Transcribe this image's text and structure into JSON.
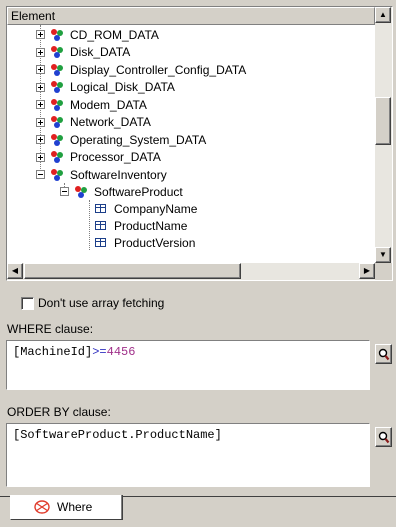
{
  "tree": {
    "header": "Element",
    "items": [
      {
        "label": "CD_ROM_DATA",
        "expander": "plus"
      },
      {
        "label": "Disk_DATA",
        "expander": "plus"
      },
      {
        "label": "Display_Controller_Config_DATA",
        "expander": "plus"
      },
      {
        "label": "Logical_Disk_DATA",
        "expander": "plus"
      },
      {
        "label": "Modem_DATA",
        "expander": "plus"
      },
      {
        "label": "Network_DATA",
        "expander": "plus"
      },
      {
        "label": "Operating_System_DATA",
        "expander": "plus"
      },
      {
        "label": "Processor_DATA",
        "expander": "plus"
      },
      {
        "label": "SoftwareInventory",
        "expander": "minus"
      }
    ],
    "child": {
      "label": "SoftwareProduct",
      "expander": "minus"
    },
    "fields": [
      "CompanyName",
      "ProductName",
      "ProductVersion"
    ],
    "icons": {
      "table": "table-molecule-icon",
      "field": "field-icon"
    }
  },
  "options": {
    "array_fetching_label": "Don't use array fetching",
    "array_fetching_checked": false
  },
  "where": {
    "label": "WHERE clause:",
    "value_left": "[MachineId]",
    "value_op": ">=",
    "value_num": "4456"
  },
  "order_by": {
    "label": "ORDER BY clause:",
    "value": "[SoftwareProduct.ProductName]"
  },
  "tabs": [
    {
      "label": "Where",
      "active": true
    }
  ],
  "colors": {
    "number": "#a0308a",
    "op": "#3030c0",
    "tab_icon": "#e03a2a"
  }
}
